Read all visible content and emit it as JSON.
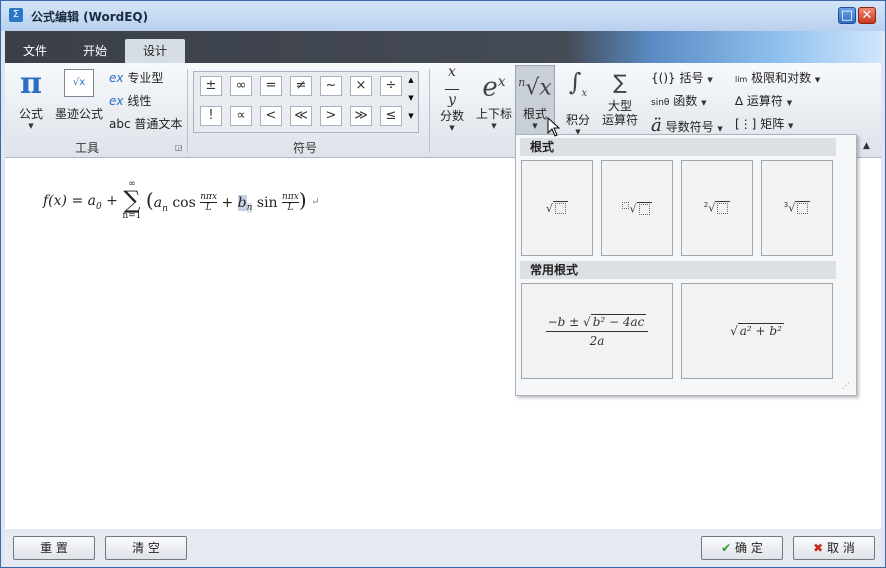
{
  "window": {
    "title": "公式编辑 (WordEQ)",
    "icon": "app-icon",
    "max_icon": "□",
    "close_icon": "✕"
  },
  "tabs": [
    {
      "label": "文件",
      "active": false
    },
    {
      "label": "开始",
      "active": false
    },
    {
      "label": "设计",
      "active": true
    }
  ],
  "ribbon": {
    "tools": {
      "group_label": "工具",
      "formula": "公式",
      "ink_formula": "墨迹公式",
      "professional": "专业型",
      "linear": "线性",
      "plain_text": "普通文本"
    },
    "symbols": {
      "group_label": "符号",
      "row1": [
        "±",
        "∞",
        "=",
        "≠",
        "~",
        "×",
        "÷"
      ],
      "row2": [
        "!",
        "∝",
        "<",
        "≪",
        ">",
        "≫",
        "≤"
      ]
    },
    "structures": {
      "fraction": "分数",
      "script": "上下标",
      "radical": "根式",
      "integral": "积分",
      "large_operator": "大型\n运算符",
      "bracket": "括号",
      "function": "函数",
      "accent": "导数符号",
      "limit_log": "极限和对数",
      "operator": "运算符",
      "matrix": "矩阵"
    }
  },
  "editor": {
    "formula_text": "f(x) = a0 + Σ(n=1..∞) (an cos(nπx/L) + bn sin(nπx/L))"
  },
  "dropdown": {
    "section1_title": "根式",
    "section2_title": "常用根式",
    "radicals": [
      "√□",
      "□√□",
      "²√□",
      "³√□"
    ],
    "common": [
      "−b ± √(b² − 4ac) / 2a",
      "√(a² + b²)"
    ]
  },
  "buttons": {
    "reset": "重 置",
    "clear": "清 空",
    "ok": "确 定",
    "cancel": "取 消"
  }
}
